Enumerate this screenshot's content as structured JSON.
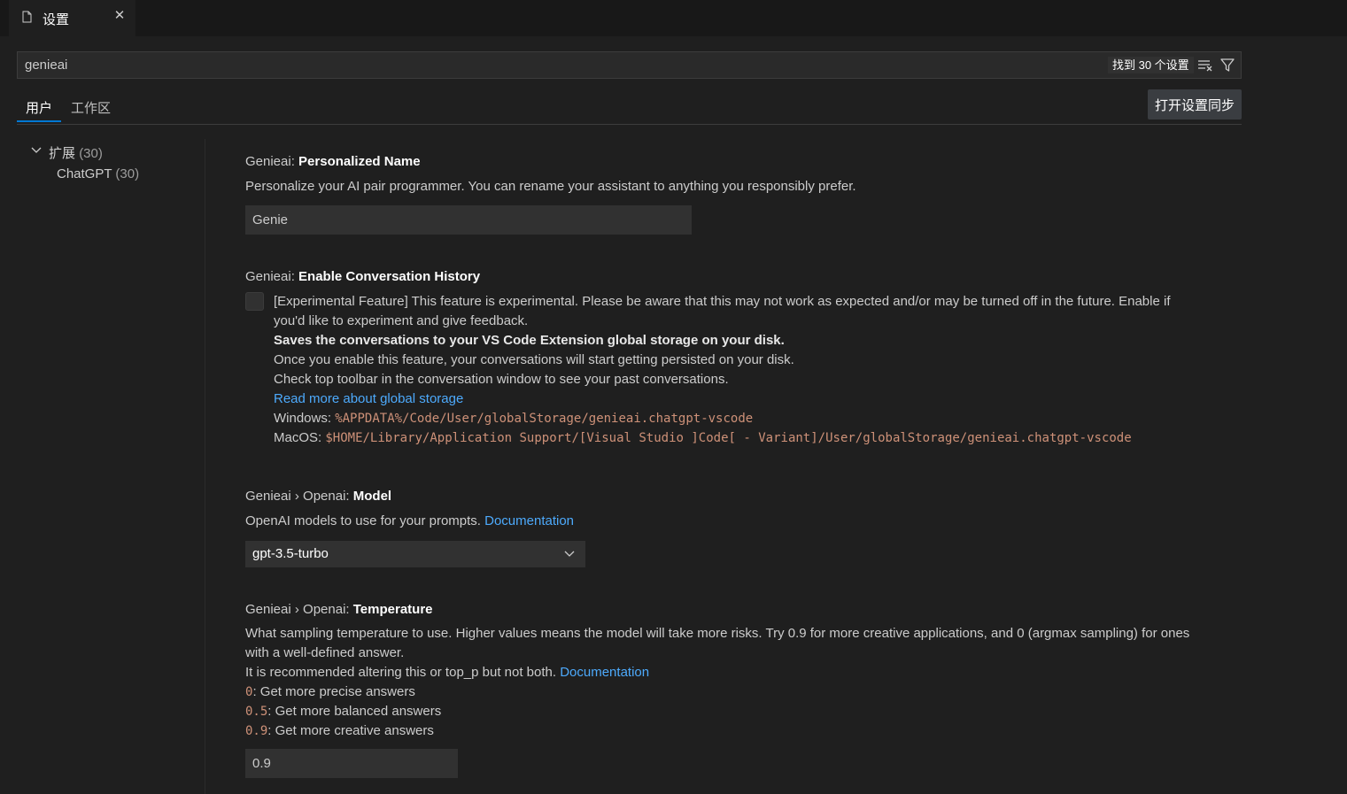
{
  "tab": {
    "title": "设置",
    "file_icon": "file-icon",
    "close_icon": "close-icon"
  },
  "search": {
    "value": "genieai",
    "result_count": "找到 30 个设置",
    "clear_icon": "clear-filter-icon",
    "filter_icon": "filter-icon"
  },
  "scopes": {
    "user": "用户",
    "workspace": "工作区",
    "sync_button": "打开设置同步"
  },
  "toc": {
    "extensions_label": "扩展",
    "extensions_count": "(30)",
    "chatgpt_label": "ChatGPT",
    "chatgpt_count": "(30)"
  },
  "settings": {
    "name": {
      "prefix": "Genieai: ",
      "title": "Personalized Name",
      "description": "Personalize your AI pair programmer. You can rename your assistant to anything you responsibly prefer.",
      "value": "Genie"
    },
    "history": {
      "prefix": "Genieai: ",
      "title": "Enable Conversation History",
      "line1": "[Experimental Feature] This feature is experimental. Please be aware that this may not work as expected and/or may be turned off in the future. Enable if",
      "line2": "you'd like to experiment and give feedback.",
      "line3": "Saves the conversations to your VS Code Extension global storage on your disk.",
      "line4": "Once you enable this feature, your conversations will start getting persisted on your disk.",
      "line5": "Check top toolbar in the conversation window to see your past conversations.",
      "link": "Read more about global storage",
      "windows_label": "Windows: ",
      "windows_path": "%APPDATA%/Code/User/globalStorage/genieai.chatgpt-vscode",
      "macos_label": "MacOS: ",
      "macos_path": "$HOME/Library/Application Support/[Visual Studio ]Code[ - Variant]/User/globalStorage/genieai.chatgpt-vscode",
      "checked": false
    },
    "model": {
      "prefix": "Genieai › Openai: ",
      "title": "Model",
      "description": "OpenAI models to use for your prompts. ",
      "link": "Documentation",
      "value": "gpt-3.5-turbo"
    },
    "temperature": {
      "prefix": "Genieai › Openai: ",
      "title": "Temperature",
      "line1": "What sampling temperature to use. Higher values means the model will take more risks. Try 0.9 for more creative applications, and 0 (argmax sampling) for ones",
      "line2": "with a well-defined answer.",
      "line3": "It is recommended altering this or top_p but not both. ",
      "link": "Documentation",
      "opt0_code": "0",
      "opt0_text": ": Get more precise answers",
      "opt1_code": "0.5",
      "opt1_text": ": Get more balanced answers",
      "opt2_code": "0.9",
      "opt2_text": ": Get more creative answers",
      "value": "0.9"
    }
  },
  "colors": {
    "link": "#4daafc",
    "code": "#ce9178",
    "accent": "#0078d4"
  }
}
